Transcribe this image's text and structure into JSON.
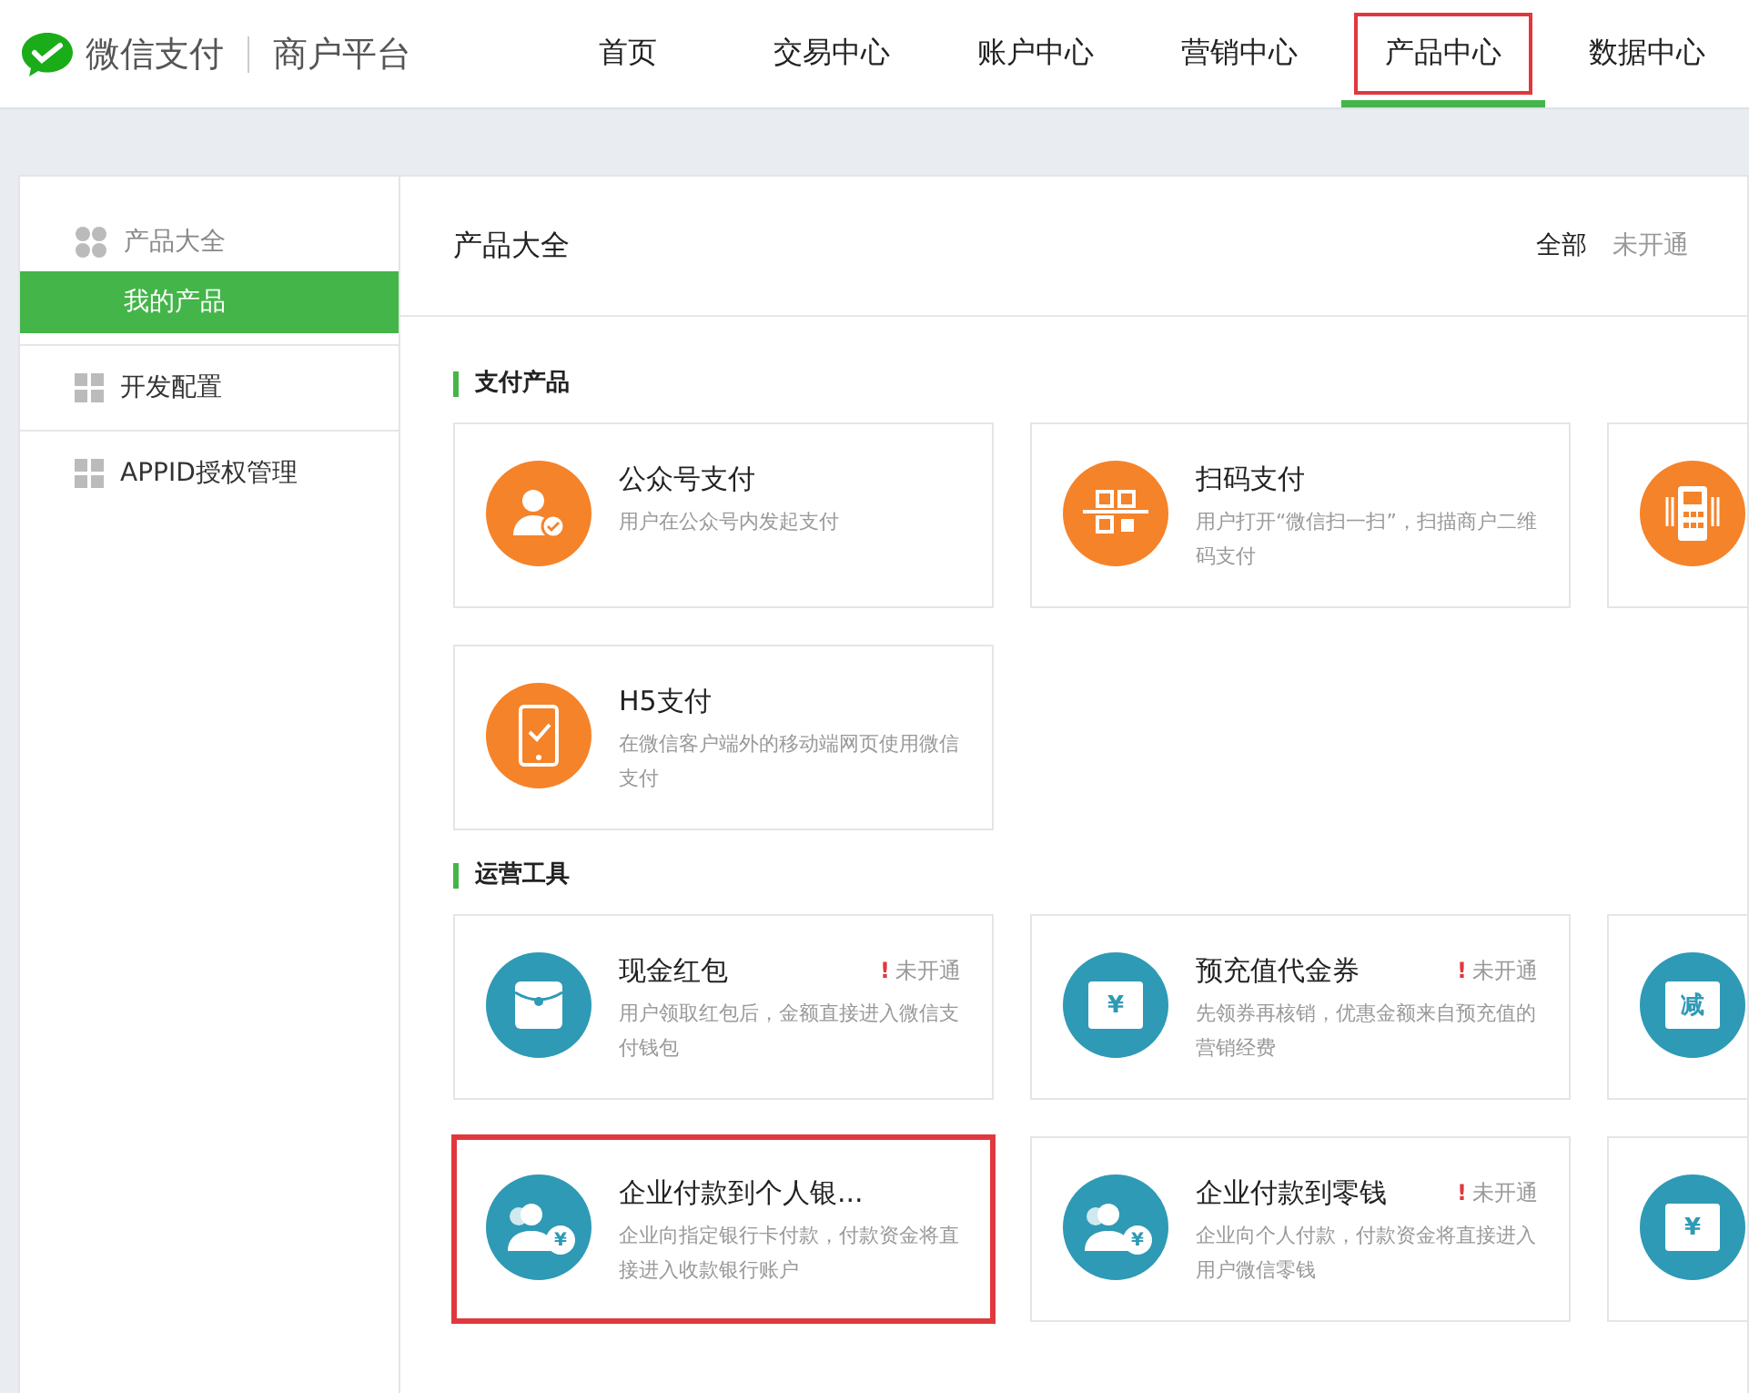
{
  "header": {
    "brand": "微信支付",
    "subtitle": "商户平台",
    "nav": [
      {
        "label": "首页",
        "selected": false,
        "highlighted": false
      },
      {
        "label": "交易中心",
        "selected": false,
        "highlighted": false
      },
      {
        "label": "账户中心",
        "selected": false,
        "highlighted": false
      },
      {
        "label": "营销中心",
        "selected": false,
        "highlighted": false
      },
      {
        "label": "产品中心",
        "selected": true,
        "highlighted": true
      },
      {
        "label": "数据中心",
        "selected": false,
        "highlighted": false
      }
    ]
  },
  "sidebar": {
    "items": [
      {
        "label": "产品大全",
        "kind": "group",
        "selected": false,
        "children": [
          {
            "label": "我的产品",
            "selected": true
          }
        ]
      },
      {
        "label": "开发配置",
        "kind": "link",
        "selected": false
      },
      {
        "label": "APPID授权管理",
        "kind": "link",
        "selected": false
      }
    ]
  },
  "content": {
    "title": "产品大全",
    "filters": [
      {
        "label": "全部",
        "selected": true
      },
      {
        "label": "未开通",
        "selected": false
      }
    ],
    "sections": [
      {
        "title": "支付产品",
        "color": "#f5832a",
        "cards": [
          {
            "kind": "person",
            "title": "公众号支付",
            "description": "用户在公众号内发起支付",
            "highlighted": false
          },
          {
            "kind": "qr",
            "title": "扫码支付",
            "description": "用户打开“微信扫一扫”，扫描商户二维码支付",
            "highlighted": false
          },
          {
            "kind": "terminal",
            "highlighted": false
          },
          {
            "kind": "phone",
            "title": "H5支付",
            "description": "在微信客户端外的移动端网页使用微信支付",
            "highlighted": false
          }
        ]
      },
      {
        "title": "运营工具",
        "color": "#2e9ab5",
        "cards": [
          {
            "kind": "envelope",
            "title": "现金红包",
            "status": {
              "mark": "!",
              "label": "未开通"
            },
            "description": "用户领取红包后，金额直接进入微信支付钱包",
            "highlighted": false
          },
          {
            "kind": "voucher",
            "icon_text": "¥",
            "title": "预充值代金券",
            "status": {
              "mark": "!",
              "label": "未开通"
            },
            "description": "先领券再核销，优惠金额来自预充值的营销经费",
            "highlighted": false
          },
          {
            "kind": "voucher",
            "icon_text": "减",
            "highlighted": false
          },
          {
            "kind": "people",
            "icon_text": "¥",
            "title": "企业付款到个人银...",
            "description": "企业向指定银行卡付款，付款资金将直接进入收款银行账户",
            "highlighted": true
          },
          {
            "kind": "people",
            "icon_text": "¥",
            "title": "企业付款到零钱",
            "status": {
              "mark": "!",
              "label": "未开通"
            },
            "description": "企业向个人付款，付款资金将直接进入用户微信零钱",
            "highlighted": false
          },
          {
            "kind": "voucher",
            "icon_text": "¥",
            "highlighted": false
          }
        ]
      }
    ]
  }
}
